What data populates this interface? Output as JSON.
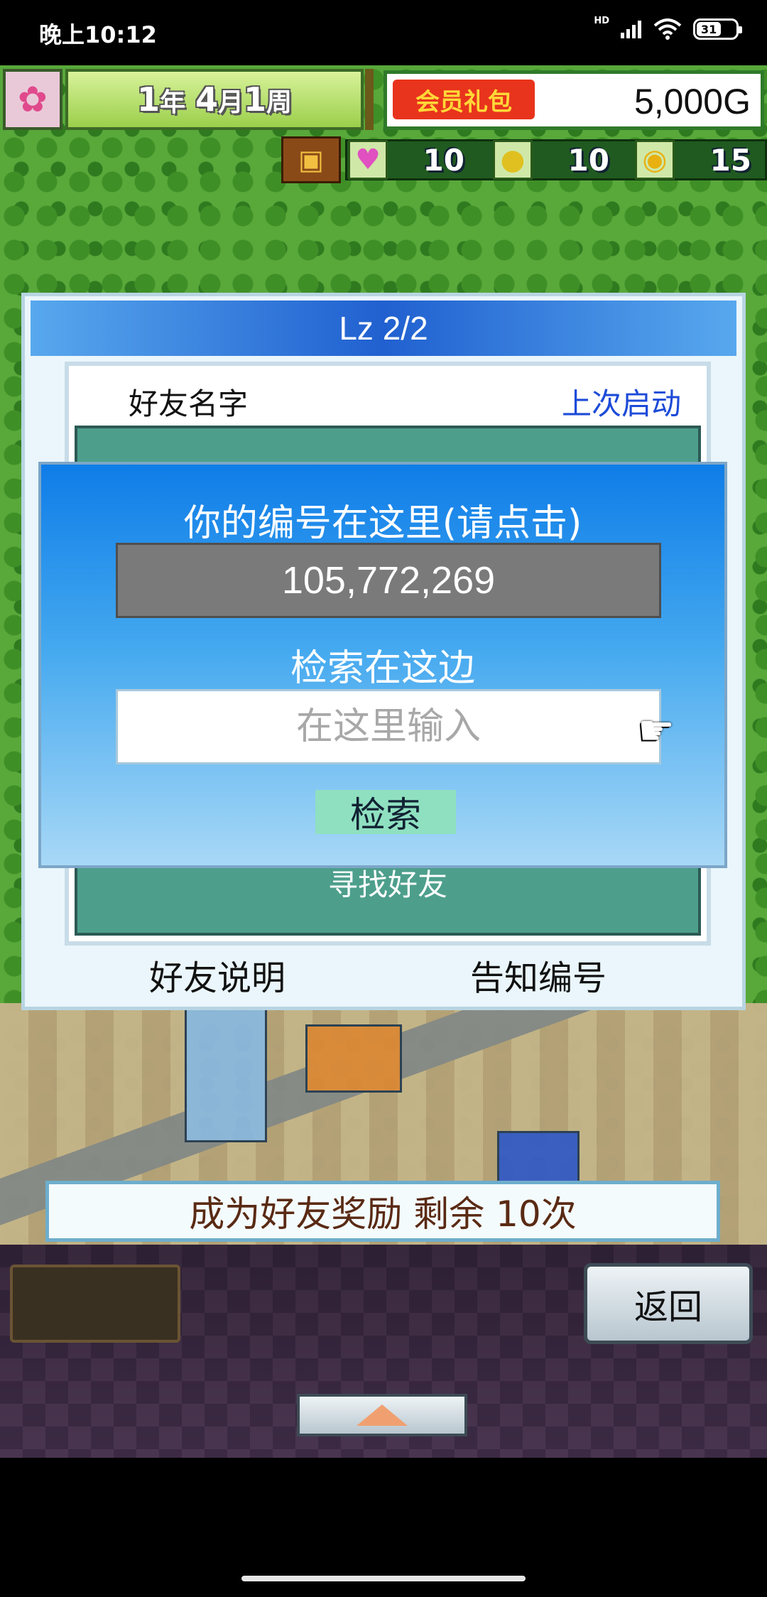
{
  "status_bar": {
    "time": "晚上10:12",
    "network_label": "HD",
    "battery_level": "31"
  },
  "hud": {
    "year": "1",
    "year_unit": "年",
    "month": "4",
    "month_unit": "月",
    "week": "1",
    "week_unit": "周",
    "member_pack_label": "会员礼包",
    "money": "5,000G",
    "hearts": "10",
    "ideas": "10",
    "coins": "15"
  },
  "dialog": {
    "title": "Lz 2/2",
    "col_friend_name": "好友名字",
    "col_last_launch": "上次启动",
    "find_friend": "寻找好友",
    "friend_explain": "好友说明",
    "notify_id": "告知编号"
  },
  "search_popup": {
    "your_id_label": "你的编号在这里(请点击)",
    "player_id": "105,772,269",
    "search_here_label": "检索在这边",
    "search_placeholder": "在这里输入",
    "search_button": "检索"
  },
  "bonus_banner": "成为好友奖励 剩余 10次",
  "bottom_menu": {
    "back_button": "返回"
  }
}
